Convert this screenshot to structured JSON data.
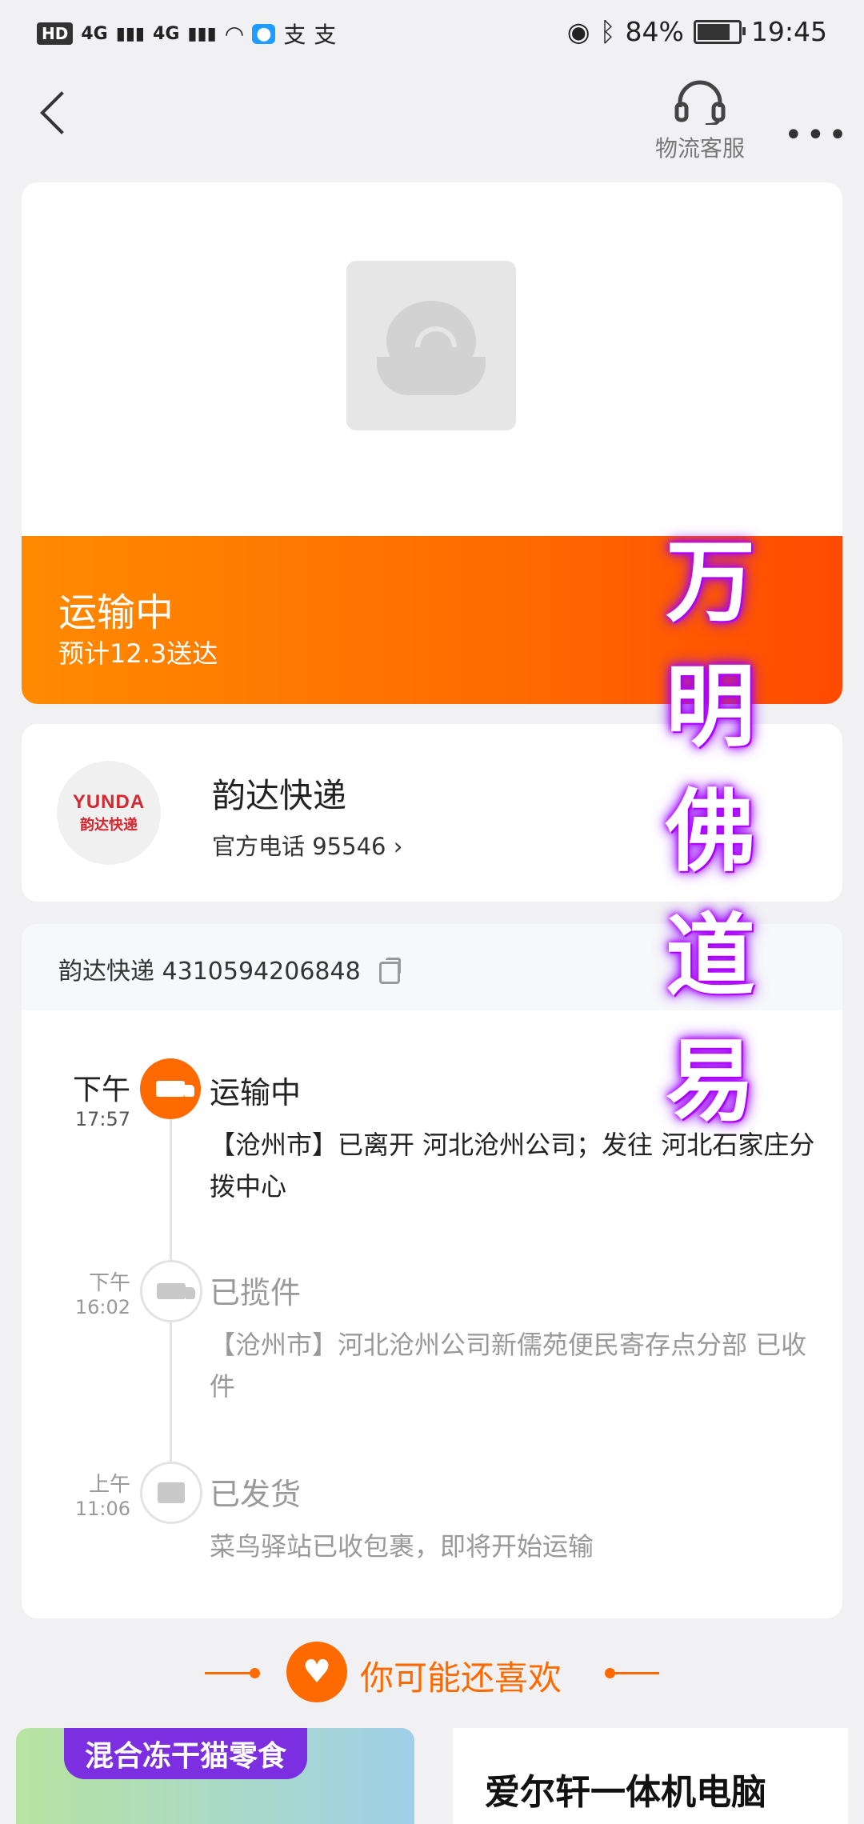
{
  "status_bar": {
    "left_icons": [
      "HD1",
      "4G",
      "4G",
      "wifi",
      "bulb-app",
      "支",
      "支"
    ],
    "left_labels": {
      "hd": "HD",
      "net1": "4G",
      "net2": "4G",
      "app1": "支",
      "app2": "支"
    },
    "battery": "84%",
    "battery_level": 0.84,
    "time": "19:45"
  },
  "nav": {
    "service_label": "物流客服",
    "more_label": "•••"
  },
  "shipment": {
    "status_title": "运输中",
    "eta": "预计12.3送达"
  },
  "courier": {
    "logo_en": "YUNDA",
    "logo_cn": "韵达快递",
    "name": "韵达快递",
    "phone": "官方电话 95546 ›"
  },
  "tracking": {
    "number_label": "韵达快递 4310594206848",
    "events": [
      {
        "ampm": "下午",
        "time": "17:57",
        "status": "运输中",
        "desc": "【沧州市】已离开 河北沧州公司；发往 河北石家庄分拨中心",
        "icon": "truck-icon"
      },
      {
        "ampm": "下午",
        "time": "16:02",
        "status": "已揽件",
        "desc": "【沧州市】河北沧州公司新儒苑便民寄存点分部 已收件",
        "icon": "truck-icon"
      },
      {
        "ampm": "上午",
        "time": "11:06",
        "status": "已发货",
        "desc": "菜鸟驿站已收包裹，即将开始运输",
        "icon": "document-icon"
      }
    ]
  },
  "recommend": {
    "title": "你可能还喜欢",
    "products": [
      {
        "title": "混合冻干猫零食"
      },
      {
        "title": "爱尔轩一体机电脑"
      }
    ]
  },
  "watermark": [
    "万",
    "明",
    "佛",
    "道",
    "易"
  ],
  "colors": {
    "accent": "#ff6a00",
    "band_start": "#ff8a00",
    "band_end": "#ff4a00",
    "watermark_glow": "#a000ff"
  }
}
